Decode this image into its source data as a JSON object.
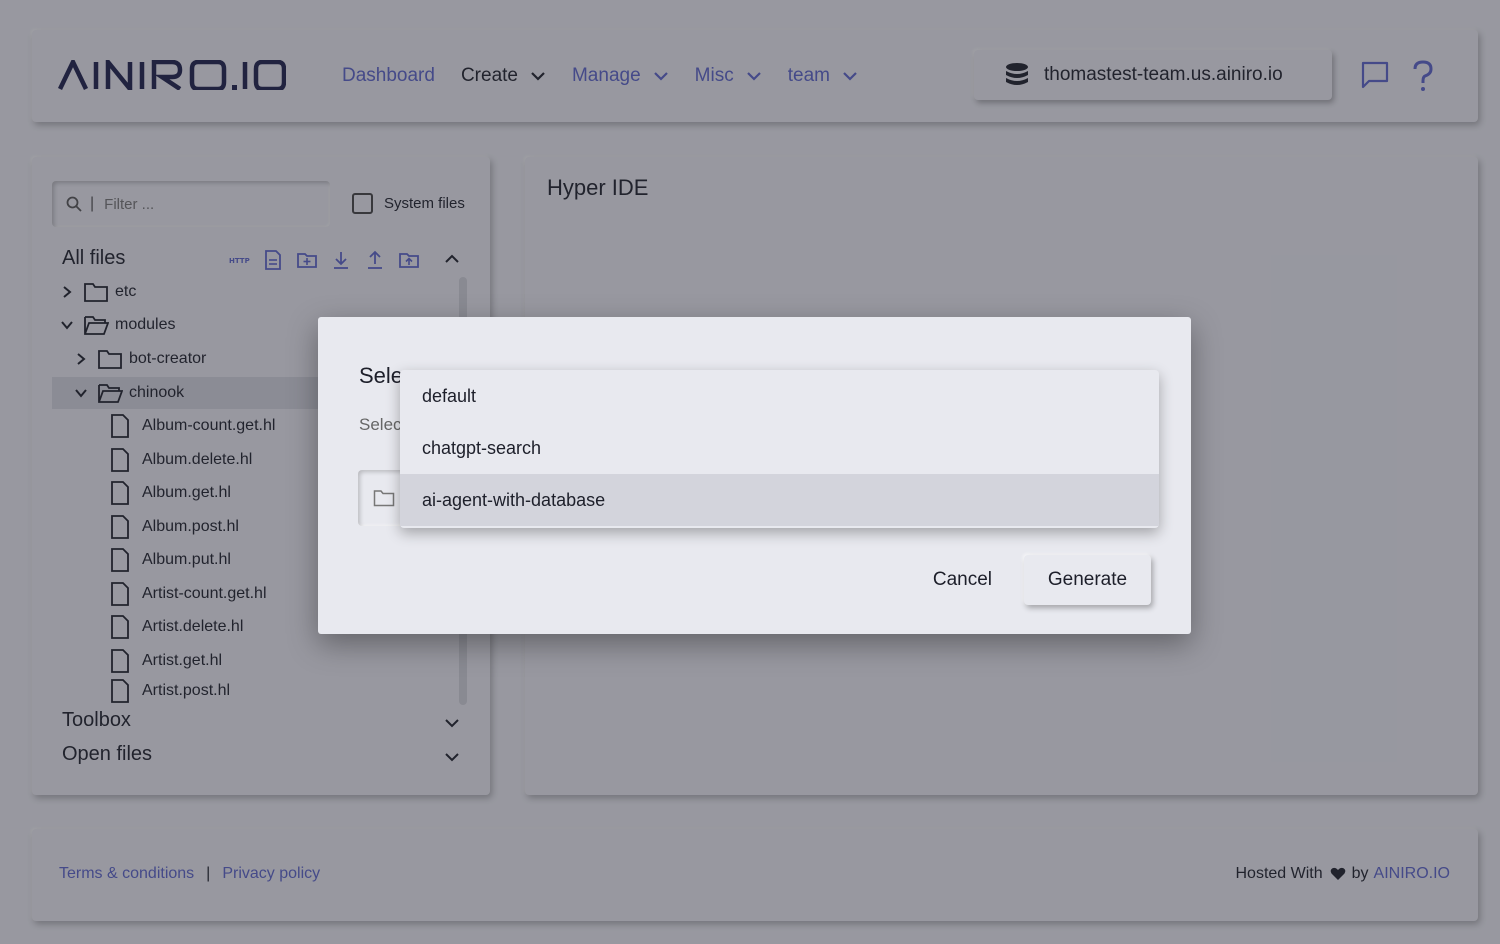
{
  "header": {
    "logo": "AINIRO.IO",
    "nav": [
      {
        "label": "Dashboard",
        "link": true,
        "dropdown": false
      },
      {
        "label": "Create",
        "link": false,
        "dropdown": true
      },
      {
        "label": "Manage",
        "link": true,
        "dropdown": true
      },
      {
        "label": "Misc",
        "link": true,
        "dropdown": true
      },
      {
        "label": "team",
        "link": true,
        "dropdown": true
      }
    ],
    "server": "thomastest-team.us.ainiro.io",
    "icons": [
      "chat-icon",
      "help-icon"
    ]
  },
  "left_panel": {
    "filter_placeholder": "Filter ...",
    "system_files_label": "System files",
    "all_files_title": "All files",
    "toolbar_icons": [
      "http-icon",
      "new-file-icon",
      "new-folder-icon",
      "download-icon",
      "upload-icon",
      "upload-folder-icon"
    ],
    "tree": [
      {
        "name": "etc",
        "type": "folder",
        "expanded": false,
        "level": 0
      },
      {
        "name": "modules",
        "type": "folder",
        "expanded": true,
        "level": 0
      },
      {
        "name": "bot-creator",
        "type": "folder",
        "expanded": false,
        "level": 1
      },
      {
        "name": "chinook",
        "type": "folder",
        "expanded": true,
        "level": 1,
        "selected": true
      },
      {
        "name": "Album-count.get.hl",
        "type": "file",
        "level": 2
      },
      {
        "name": "Album.delete.hl",
        "type": "file",
        "level": 2
      },
      {
        "name": "Album.get.hl",
        "type": "file",
        "level": 2
      },
      {
        "name": "Album.post.hl",
        "type": "file",
        "level": 2
      },
      {
        "name": "Album.put.hl",
        "type": "file",
        "level": 2
      },
      {
        "name": "Artist-count.get.hl",
        "type": "file",
        "level": 2
      },
      {
        "name": "Artist.delete.hl",
        "type": "file",
        "level": 2
      },
      {
        "name": "Artist.get.hl",
        "type": "file",
        "level": 2
      },
      {
        "name": "Artist.post.hl",
        "type": "file",
        "level": 2
      }
    ],
    "toolbox_title": "Toolbox",
    "open_files_title": "Open files"
  },
  "right_panel": {
    "title": "Hyper IDE"
  },
  "footer": {
    "terms": "Terms & conditions",
    "privacy": "Privacy policy",
    "hosted_with": "Hosted With",
    "by": "by",
    "brand": "AINIRO.IO"
  },
  "dialog": {
    "title_visible": "Sele",
    "subtitle_visible": "Selec",
    "cancel_label": "Cancel",
    "generate_label": "Generate"
  },
  "dropdown": {
    "options": [
      "default",
      "chatgpt-search",
      "ai-agent-with-database"
    ],
    "highlighted": "ai-agent-with-database"
  },
  "colors": {
    "accent": "#5a63c8",
    "background": "#e8e9ef",
    "text": "#1d1f2a"
  }
}
